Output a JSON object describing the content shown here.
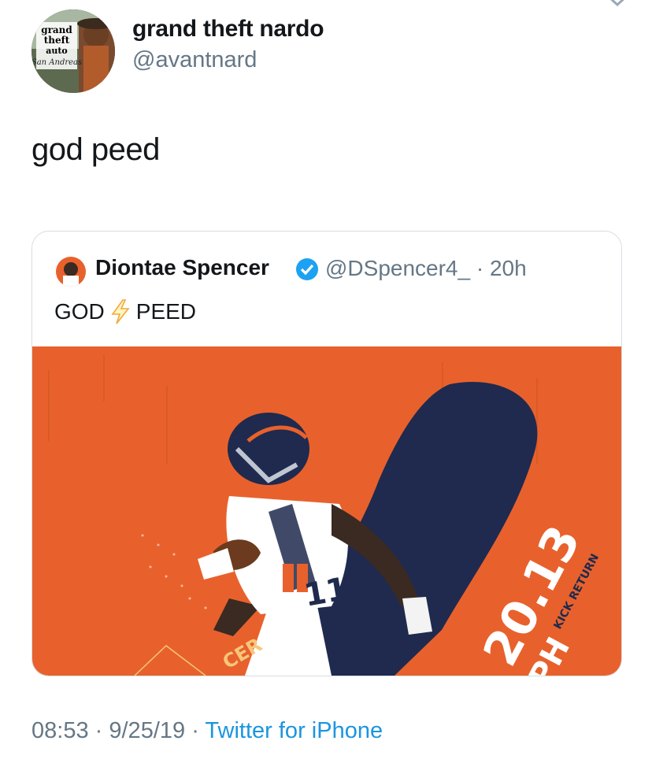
{
  "tweet": {
    "display_name": "grand theft nardo",
    "handle": "@avantnard",
    "text": "god peed",
    "avatar_text": "grand theft auto San Andreas"
  },
  "quoted_tweet": {
    "display_name": "Diontae Spencer",
    "verified": true,
    "handle": "@DSpencer4_",
    "separator": "·",
    "time": "20h",
    "text_left": "GOD",
    "text_right": "PEED",
    "media": {
      "stat_value": "20.13",
      "stat_unit_partial": "PH",
      "stat_label": "KICK RETURN",
      "corner_text": "CER",
      "jersey_number": "11"
    }
  },
  "footer": {
    "time": "08:53",
    "separator1": "·",
    "date": "9/25/19",
    "separator2": "·",
    "source": "Twitter for iPhone"
  },
  "colors": {
    "link": "#1b95e0",
    "secondary_text": "#657786",
    "broncos_orange": "#e8612c",
    "broncos_navy": "#1f2a4e"
  }
}
